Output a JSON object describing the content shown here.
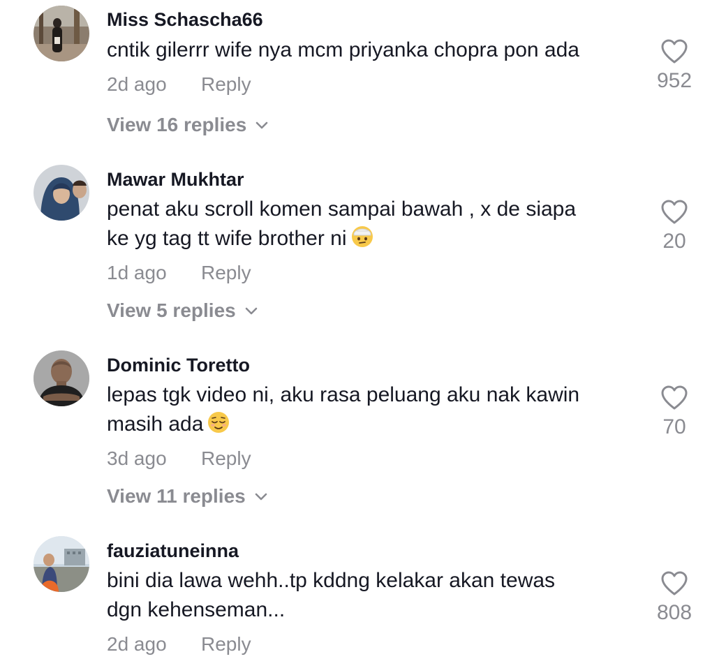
{
  "comments": [
    {
      "username": "Miss Schascha66",
      "text": "cntik gilerrr wife nya mcm priyanka chopra pon ada",
      "time": "2d ago",
      "reply_label": "Reply",
      "likes": "952",
      "view_replies": "View 16 replies"
    },
    {
      "username": "Mawar Mukhtar",
      "text_line1": "penat aku scroll komen sampai bawah , x de siapa",
      "text_line2": "ke yg tag tt wife brother ni",
      "time": "1d ago",
      "reply_label": "Reply",
      "likes": "20",
      "view_replies": "View 5 replies"
    },
    {
      "username": "Dominic Toretto",
      "text_line1": "lepas tgk video ni, aku rasa peluang aku nak kawin",
      "text_line2": "masih ada",
      "time": "3d ago",
      "reply_label": "Reply",
      "likes": "70",
      "view_replies": "View 11 replies"
    },
    {
      "username": "fauziatuneinna",
      "text_line1": "bini dia lawa wehh..tp kddng kelakar akan tewas",
      "text_line2": "dgn kehenseman...",
      "time": "2d ago",
      "reply_label": "Reply",
      "likes": "808"
    }
  ],
  "icons": {
    "heart": "heart-outline-icon",
    "chevron": "chevron-down-icon",
    "emoji_2": "face-with-head-bandage-emoji",
    "emoji_3": "relieved-face-emoji"
  },
  "colors": {
    "text": "#161823",
    "secondary": "#8a8b91",
    "background": "#ffffff"
  }
}
